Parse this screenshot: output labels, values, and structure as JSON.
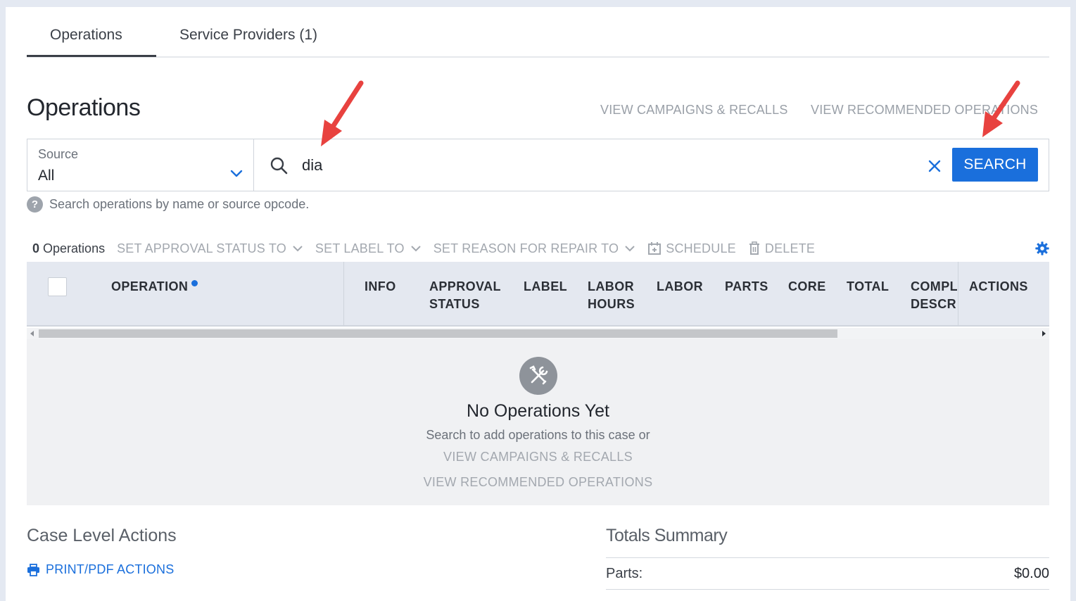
{
  "tabs": [
    {
      "label": "Operations",
      "active": true
    },
    {
      "label": "Service Providers (1)",
      "active": false
    }
  ],
  "header": {
    "title": "Operations",
    "link_campaigns": "VIEW CAMPAIGNS & RECALLS",
    "link_recommended": "VIEW RECOMMENDED OPERATIONS"
  },
  "source": {
    "label": "Source",
    "value": "All"
  },
  "search": {
    "value": "dia",
    "button_label": "SEARCH",
    "hint": "Search operations by name or source opcode."
  },
  "toolbar": {
    "count": "0",
    "count_label": "Operations",
    "set_approval": "SET APPROVAL STATUS TO",
    "set_label": "SET LABEL TO",
    "set_reason": "SET REASON FOR REPAIR TO",
    "schedule": "SCHEDULE",
    "delete": "DELETE"
  },
  "table": {
    "columns": [
      "OPERATION",
      "INFO",
      "APPROVAL STATUS",
      "LABEL",
      "LABOR HOURS",
      "LABOR",
      "PARTS",
      "CORE",
      "TOTAL",
      "COMPL DESCRI",
      "ACTIONS"
    ]
  },
  "empty_state": {
    "title": "No Operations Yet",
    "subtitle": "Search to add operations to this case or",
    "link_campaigns": "VIEW CAMPAIGNS & RECALLS",
    "link_recommended": "VIEW RECOMMENDED OPERATIONS"
  },
  "case_actions": {
    "title": "Case Level Actions",
    "print_link": "PRINT/PDF ACTIONS"
  },
  "totals": {
    "title": "Totals Summary",
    "rows": [
      {
        "label": "Parts:",
        "value": "$0.00"
      }
    ]
  },
  "colors": {
    "accent": "#1a6fdc",
    "annotation_arrow": "#e8423f",
    "table_header_bg": "#e4e8f0"
  }
}
